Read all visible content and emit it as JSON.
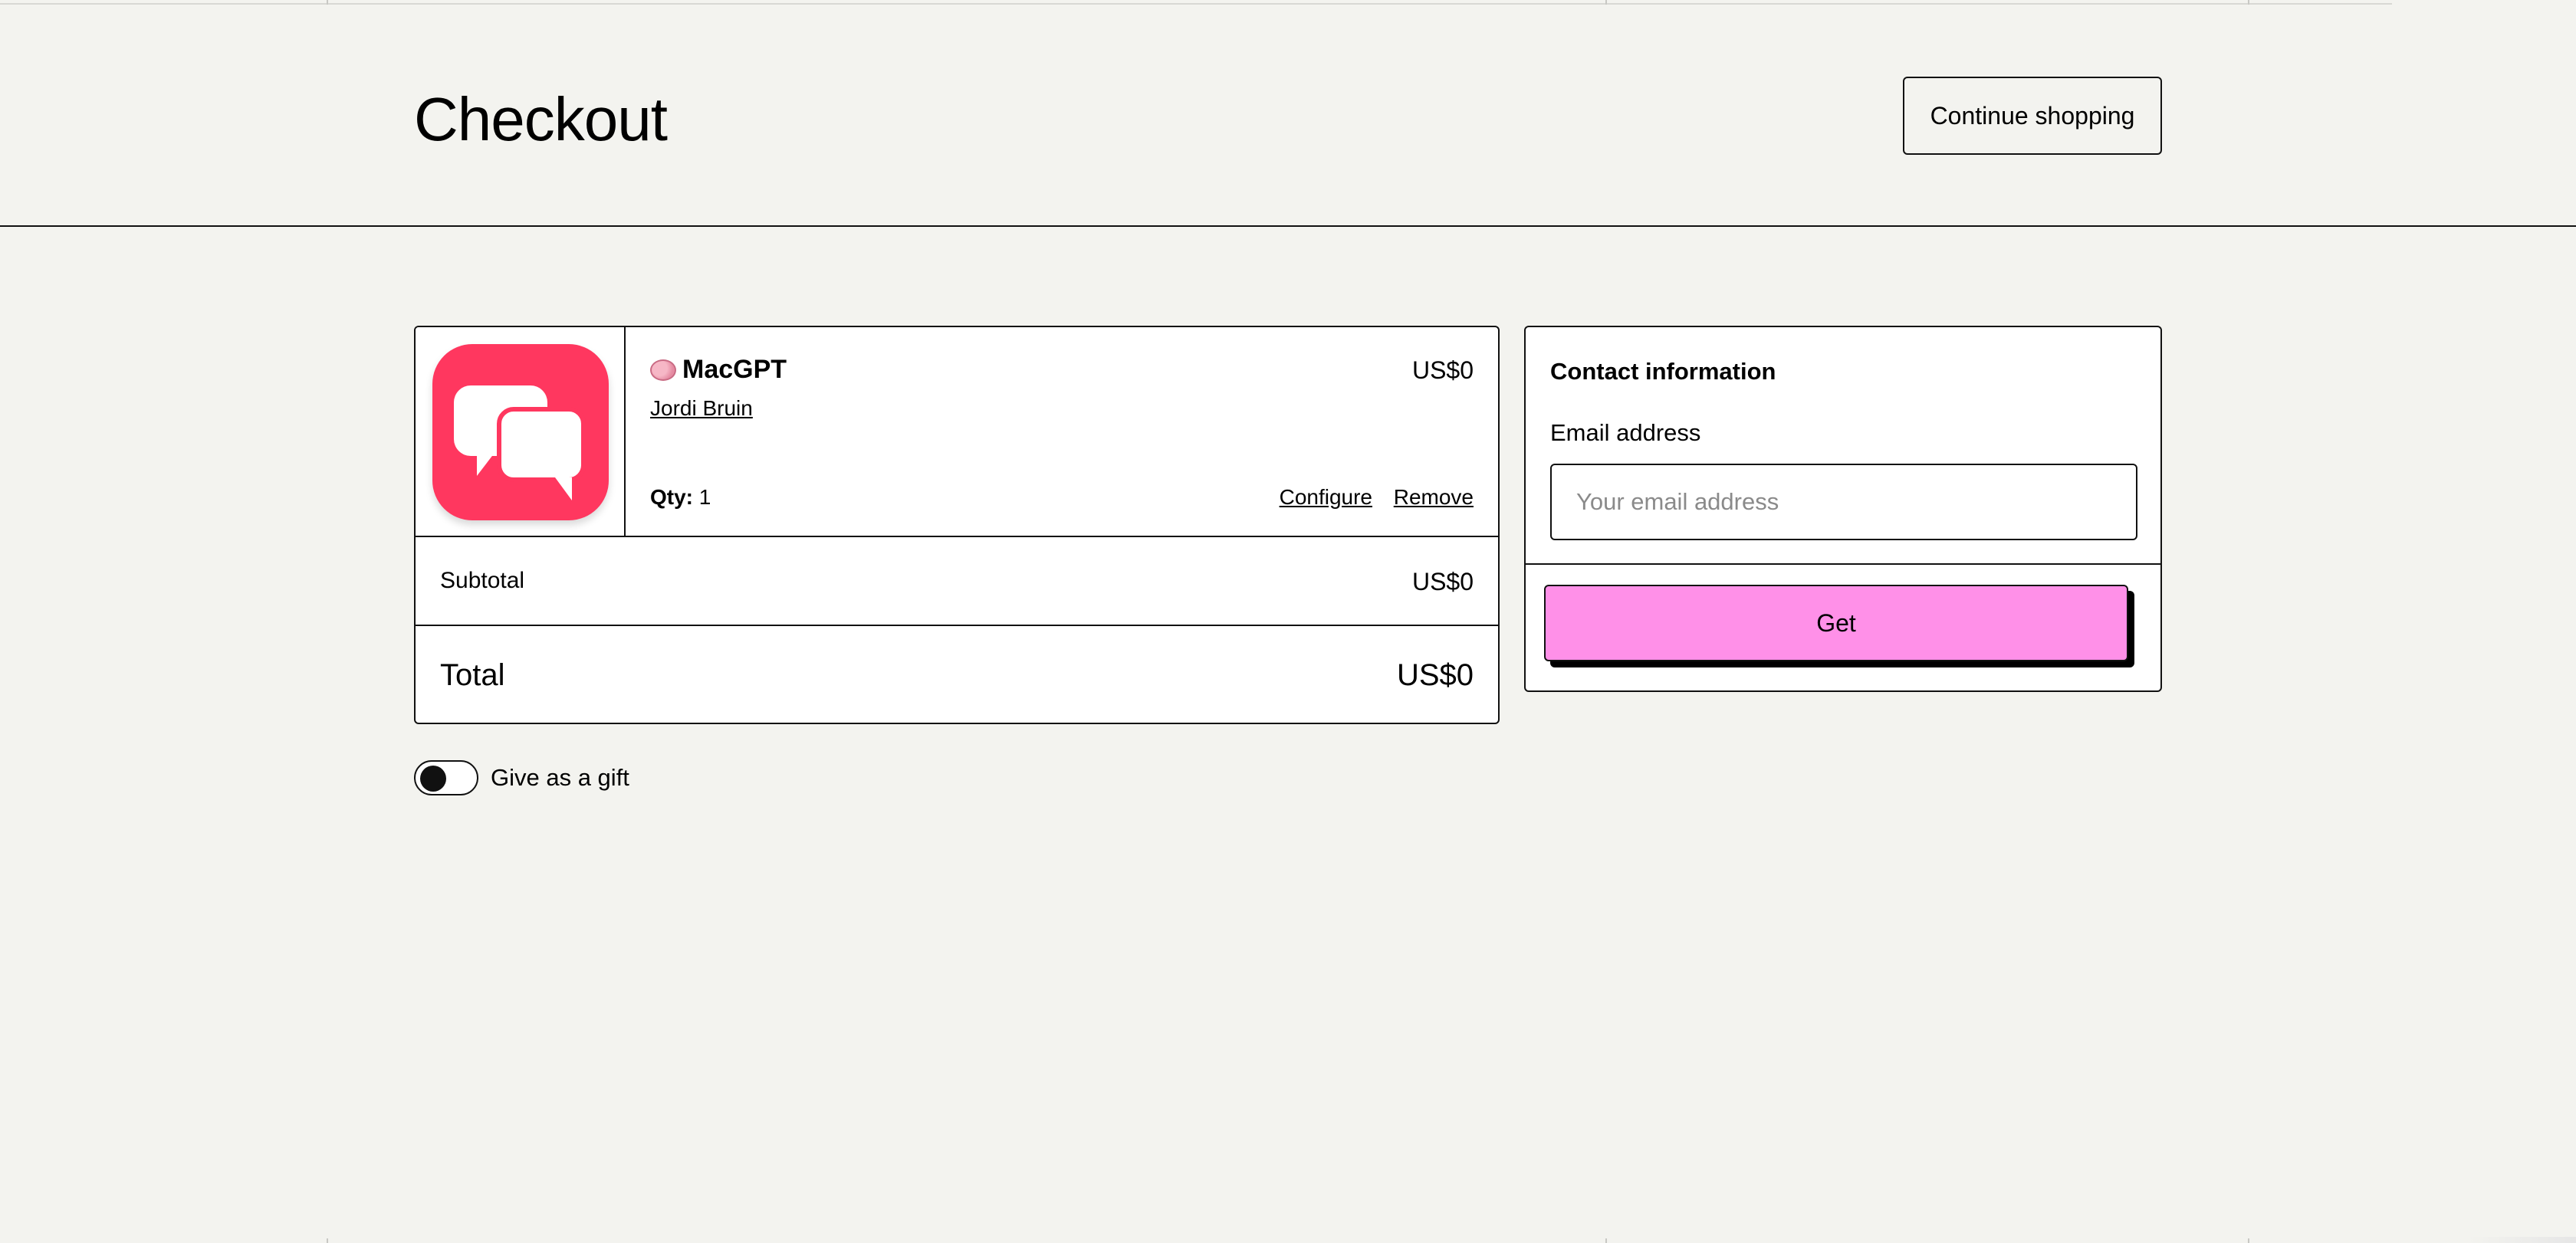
{
  "header": {
    "title": "Checkout",
    "continue_label": "Continue shopping"
  },
  "cart": {
    "item": {
      "emoji_icon": "brain-icon",
      "name": "MacGPT",
      "author": "Jordi Bruin",
      "price": "US$0",
      "qty_label": "Qty:",
      "qty_value": "1",
      "configure_label": "Configure",
      "remove_label": "Remove",
      "thumbnail_icon": "chat-bubbles-icon",
      "thumbnail_color": "#ff375f"
    },
    "subtotal_label": "Subtotal",
    "subtotal_value": "US$0",
    "total_label": "Total",
    "total_value": "US$0"
  },
  "gift": {
    "label": "Give as a gift",
    "enabled": false
  },
  "contact": {
    "title": "Contact information",
    "email_label": "Email address",
    "email_placeholder": "Your email address",
    "email_value": "",
    "submit_label": "Get",
    "submit_color": "#ff90e8"
  }
}
